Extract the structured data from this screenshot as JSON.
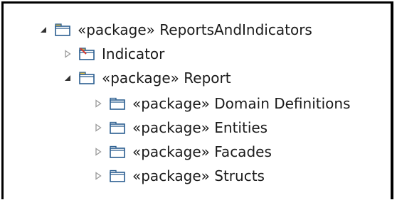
{
  "tree": {
    "items": [
      {
        "level": 0,
        "expanded": true,
        "icon": "package-folder-icon",
        "stereotype": "«package»",
        "name": "ReportsAndIndicators",
        "label": "«package» ReportsAndIndicators"
      },
      {
        "level": 1,
        "expanded": false,
        "icon": "package-folder-error-icon",
        "stereotype": "",
        "name": "Indicator",
        "label": "Indicator"
      },
      {
        "level": 1,
        "expanded": true,
        "icon": "package-folder-icon",
        "stereotype": "«package»",
        "name": "Report",
        "label": "«package» Report"
      },
      {
        "level": 2,
        "expanded": false,
        "icon": "folder-icon",
        "stereotype": "«package»",
        "name": "Domain Definitions",
        "label": "«package» Domain Definitions"
      },
      {
        "level": 2,
        "expanded": false,
        "icon": "folder-icon",
        "stereotype": "«package»",
        "name": "Entities",
        "label": "«package» Entities"
      },
      {
        "level": 2,
        "expanded": false,
        "icon": "folder-icon",
        "stereotype": "«package»",
        "name": "Facades",
        "label": "«package» Facades"
      },
      {
        "level": 2,
        "expanded": false,
        "icon": "folder-icon",
        "stereotype": "«package»",
        "name": "Structs",
        "label": "«package» Structs"
      }
    ]
  },
  "colors": {
    "folder_outline": "#2a5d8f",
    "folder_fill": "#ffffff",
    "package_tab": "#e8c24a",
    "error_mark": "#d63a2f",
    "expanded_twisty": "#333333",
    "collapsed_twisty": "#9a9a9a"
  }
}
